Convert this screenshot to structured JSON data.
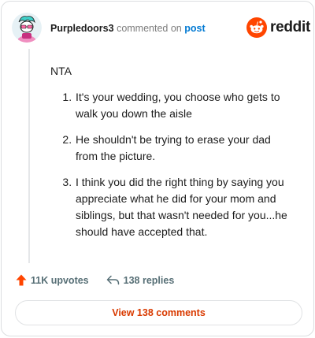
{
  "header": {
    "author": "Purpledoors3",
    "action_text": "commented on",
    "post_link": "post",
    "brand": "reddit"
  },
  "comment": {
    "intro": "NTA",
    "points": [
      "It's your wedding, you choose who gets to walk you down the aisle",
      "He shouldn't be trying to erase your dad from the picture.",
      "I think you did the right thing by saying you appreciate what he did for your mom and siblings, but that wasn't needed for you...he should have accepted that."
    ]
  },
  "actions": {
    "upvotes": "11K upvotes",
    "replies": "138 replies"
  },
  "footer": {
    "view_comments": "View 138 comments"
  },
  "colors": {
    "brand_orange": "#ff4500",
    "link_blue": "#0079d3",
    "button_text": "#d93a00"
  }
}
